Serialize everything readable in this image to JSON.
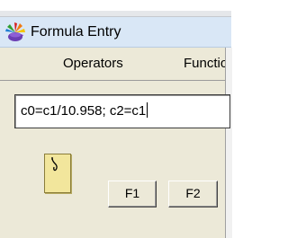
{
  "window": {
    "title": "Formula Entry",
    "app_icon": "colorful-star-app-icon"
  },
  "menubar": {
    "items": [
      {
        "label": "Operators"
      },
      {
        "label": "Functio"
      }
    ]
  },
  "formula": {
    "value": "c0=c1/10.958; c2=c1"
  },
  "note": {
    "icon": "sticky-note-icon"
  },
  "buttons": {
    "f1_label": "F1",
    "f2_label": "F2"
  }
}
